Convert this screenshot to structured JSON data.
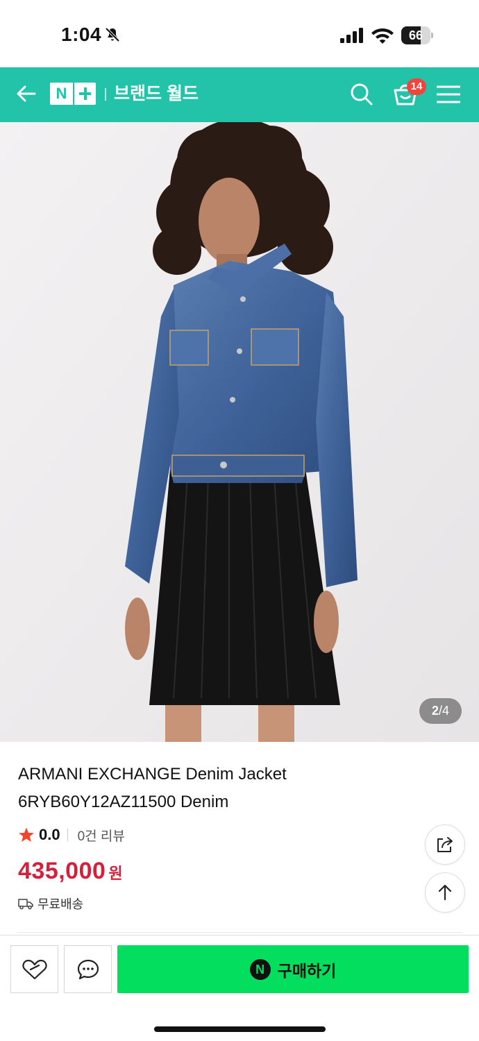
{
  "status_bar": {
    "time": "1:04",
    "battery": "66",
    "battery_level": 0.66
  },
  "header": {
    "title": "브랜드 월드",
    "logo_n": "N",
    "cart_count": "14",
    "background": "#22c3a8"
  },
  "gallery": {
    "current": "2",
    "separator": "/",
    "total": "4"
  },
  "product": {
    "title_line1": "ARMANI EXCHANGE Denim Jacket",
    "title_line2": "6RYB60Y12AZ11500 Denim",
    "rating": "0.0",
    "reviews": "0건 리뷰",
    "price": "435,000",
    "price_unit": "원",
    "shipping": "무료배송",
    "price_color": "#d3213c"
  },
  "actions": {
    "buy_label": "구매하기",
    "npay_glyph": "N",
    "buy_color": "#03de5f"
  },
  "icons": [
    "bell-off-icon",
    "signal-icon",
    "wifi-icon",
    "back-arrow-icon",
    "search-icon",
    "cart-icon",
    "menu-icon",
    "star-icon",
    "truck-icon",
    "share-icon",
    "arrow-up-icon",
    "heart-icon",
    "chat-icon",
    "npay-icon"
  ]
}
